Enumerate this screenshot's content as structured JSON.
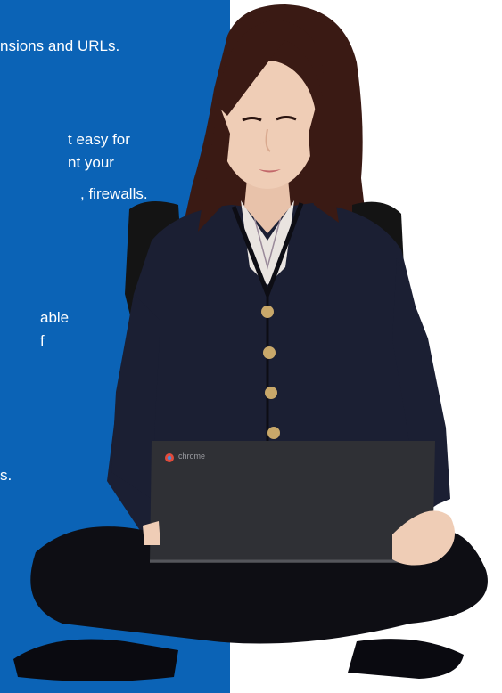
{
  "panel": {
    "color": "#0b63b6",
    "lines": [
      "nsions and URLs.",
      "t easy for",
      "nt your",
      ", firewalls.",
      "able",
      "f",
      "s."
    ]
  },
  "laptop": {
    "brand_label": "chrome"
  },
  "colors": {
    "jacket": "#1b1f33",
    "hair": "#3a1a14",
    "skin": "#efcdb6",
    "laptop": "#2f3035",
    "buttons": "#c9a86a"
  }
}
